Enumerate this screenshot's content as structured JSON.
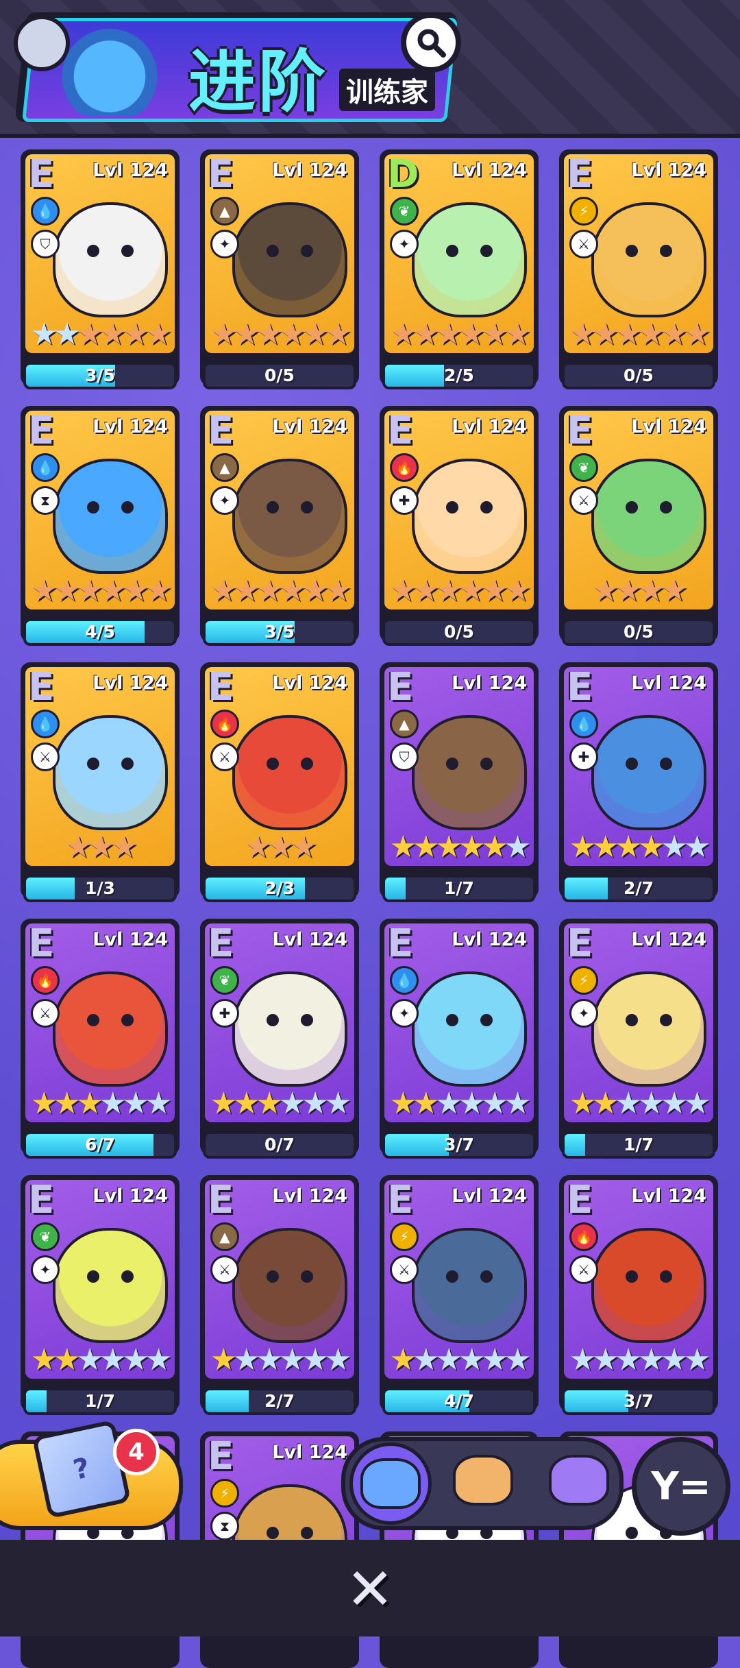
{
  "header": {
    "title": "进阶",
    "subtitle": "训练家",
    "search_icon": "search-icon"
  },
  "colors": {
    "water": "#2f8ff0",
    "earth": "#8a6a46",
    "grass": "#3fb34a",
    "electric": "#f0b000",
    "fire": "#e8334a",
    "progress_fill": "#3fd2f0",
    "card_gold": "#f7b62f",
    "card_purple": "#9050e0"
  },
  "cards": [
    {
      "grade": "E",
      "level": "Lvl 124",
      "type": "water",
      "role": "shield",
      "bg": "gold",
      "creature": "#f2f2f2",
      "stars": [
        [
          "silver",
          2
        ],
        [
          "bronze",
          4
        ]
      ],
      "progress": "3/5",
      "fill": 0.6
    },
    {
      "grade": "E",
      "level": "Lvl 124",
      "type": "earth",
      "role": "bolt",
      "bg": "gold",
      "creature": "#5c4a3a",
      "stars": [
        [
          "bronze",
          6
        ]
      ],
      "progress": "0/5",
      "fill": 0
    },
    {
      "grade": "D",
      "level": "Lvl 124",
      "type": "grass",
      "role": "bolt",
      "bg": "gold",
      "creature": "#b8f0b0",
      "stars": [
        [
          "bronze",
          6
        ]
      ],
      "progress": "2/5",
      "fill": 0.4
    },
    {
      "grade": "E",
      "level": "Lvl 124",
      "type": "electric",
      "role": "sword",
      "bg": "gold",
      "creature": "#f5c05a",
      "stars": [
        [
          "bronze",
          6
        ]
      ],
      "progress": "0/5",
      "fill": 0
    },
    {
      "grade": "E",
      "level": "Lvl 124",
      "type": "water",
      "role": "potion",
      "bg": "gold",
      "creature": "#4aa8ff",
      "stars": [
        [
          "bronze",
          6
        ]
      ],
      "progress": "4/5",
      "fill": 0.8
    },
    {
      "grade": "E",
      "level": "Lvl 124",
      "type": "earth",
      "role": "bolt",
      "bg": "gold",
      "creature": "#7a5a44",
      "stars": [
        [
          "bronze",
          6
        ]
      ],
      "progress": "3/5",
      "fill": 0.6
    },
    {
      "grade": "E",
      "level": "Lvl 124",
      "type": "fire",
      "role": "heal",
      "bg": "gold",
      "creature": "#ffd9a8",
      "stars": [
        [
          "bronze",
          6
        ]
      ],
      "progress": "0/5",
      "fill": 0
    },
    {
      "grade": "E",
      "level": "Lvl 124",
      "type": "grass",
      "role": "sword",
      "bg": "gold",
      "creature": "#7bd37a",
      "stars": [
        [
          "bronze",
          4
        ]
      ],
      "progress": "0/5",
      "fill": 0
    },
    {
      "grade": "E",
      "level": "Lvl 124",
      "type": "water",
      "role": "sword",
      "bg": "gold",
      "creature": "#9ad6ff",
      "stars": [
        [
          "bronze",
          3
        ]
      ],
      "progress": "1/3",
      "fill": 0.33
    },
    {
      "grade": "E",
      "level": "Lvl 124",
      "type": "fire",
      "role": "sword",
      "bg": "gold",
      "creature": "#e84a3a",
      "stars": [
        [
          "bronze",
          3
        ]
      ],
      "progress": "2/3",
      "fill": 0.67
    },
    {
      "grade": "E",
      "level": "Lvl 124",
      "type": "earth",
      "role": "shield",
      "bg": "purple",
      "creature": "#8a6446",
      "stars": [
        [
          "gold",
          5
        ],
        [
          "silver",
          1
        ]
      ],
      "progress": "1/7",
      "fill": 0.14
    },
    {
      "grade": "E",
      "level": "Lvl 124",
      "type": "water",
      "role": "heal",
      "bg": "purple",
      "creature": "#4a8fe0",
      "stars": [
        [
          "gold",
          4
        ],
        [
          "silver",
          2
        ]
      ],
      "progress": "2/7",
      "fill": 0.29
    },
    {
      "grade": "E",
      "level": "Lvl 124",
      "type": "fire",
      "role": "sword",
      "bg": "purple",
      "creature": "#e8553a",
      "stars": [
        [
          "gold",
          3
        ],
        [
          "silver",
          3
        ]
      ],
      "progress": "6/7",
      "fill": 0.86
    },
    {
      "grade": "E",
      "level": "Lvl 124",
      "type": "grass",
      "role": "heal",
      "bg": "purple",
      "creature": "#f2f0e0",
      "stars": [
        [
          "gold",
          3
        ],
        [
          "silver",
          3
        ]
      ],
      "progress": "0/7",
      "fill": 0
    },
    {
      "grade": "E",
      "level": "Lvl 124",
      "type": "water",
      "role": "bolt",
      "bg": "purple",
      "creature": "#7fd8f8",
      "stars": [
        [
          "gold",
          2
        ],
        [
          "silver",
          4
        ]
      ],
      "progress": "3/7",
      "fill": 0.43
    },
    {
      "grade": "E",
      "level": "Lvl 124",
      "type": "electric",
      "role": "bolt",
      "bg": "purple",
      "creature": "#f5df8a",
      "stars": [
        [
          "gold",
          2
        ],
        [
          "silver",
          4
        ]
      ],
      "progress": "1/7",
      "fill": 0.14
    },
    {
      "grade": "E",
      "level": "Lvl 124",
      "type": "grass",
      "role": "bolt",
      "bg": "purple",
      "creature": "#eaf06a",
      "stars": [
        [
          "gold",
          2
        ],
        [
          "silver",
          4
        ]
      ],
      "progress": "1/7",
      "fill": 0.14
    },
    {
      "grade": "E",
      "level": "Lvl 124",
      "type": "earth",
      "role": "sword",
      "bg": "purple",
      "creature": "#7a4a38",
      "stars": [
        [
          "gold",
          1
        ],
        [
          "silver",
          5
        ]
      ],
      "progress": "2/7",
      "fill": 0.29
    },
    {
      "grade": "E",
      "level": "Lvl 124",
      "type": "electric",
      "role": "sword",
      "bg": "purple",
      "creature": "#4a6a9a",
      "stars": [
        [
          "gold",
          1
        ],
        [
          "silver",
          5
        ]
      ],
      "progress": "4/7",
      "fill": 0.57
    },
    {
      "grade": "E",
      "level": "Lvl 124",
      "type": "fire",
      "role": "sword",
      "bg": "purple",
      "creature": "#d84a2a",
      "stars": [
        [
          "silver",
          6
        ]
      ],
      "progress": "3/7",
      "fill": 0.43
    },
    {
      "grade": "",
      "level": "",
      "type": "",
      "role": "",
      "bg": "purple",
      "creature": "#ffffff",
      "stars": [],
      "progress": "",
      "fill": 0
    },
    {
      "grade": "E",
      "level": "Lvl 124",
      "type": "electric",
      "role": "potion",
      "bg": "purple",
      "creature": "#d9a050",
      "stars": [],
      "progress": "",
      "fill": 0
    },
    {
      "grade": "",
      "level": "",
      "type": "",
      "role": "",
      "bg": "purple",
      "creature": "#ffffff",
      "stars": [],
      "progress": "",
      "fill": 0
    },
    {
      "grade": "",
      "level": "",
      "type": "",
      "role": "",
      "bg": "purple",
      "creature": "#ffffff",
      "stars": [],
      "progress": "",
      "fill": 0
    }
  ],
  "chest": {
    "count": "4",
    "icon": "mystery-box-icon",
    "label": "?"
  },
  "tabs": [
    {
      "name": "tab-cat",
      "icon": "cat-icon",
      "color": "#6aa8ff",
      "active": true
    },
    {
      "name": "tab-hamster",
      "icon": "hamster-icon",
      "color": "#f2b46a",
      "active": false
    },
    {
      "name": "tab-star-cat",
      "icon": "star-cat-icon",
      "color": "#9f7af5",
      "active": false
    }
  ],
  "filter": {
    "icon": "filter-icon",
    "glyph": "Y="
  },
  "footer": {
    "close_glyph": "✕",
    "close_icon": "close-icon"
  }
}
